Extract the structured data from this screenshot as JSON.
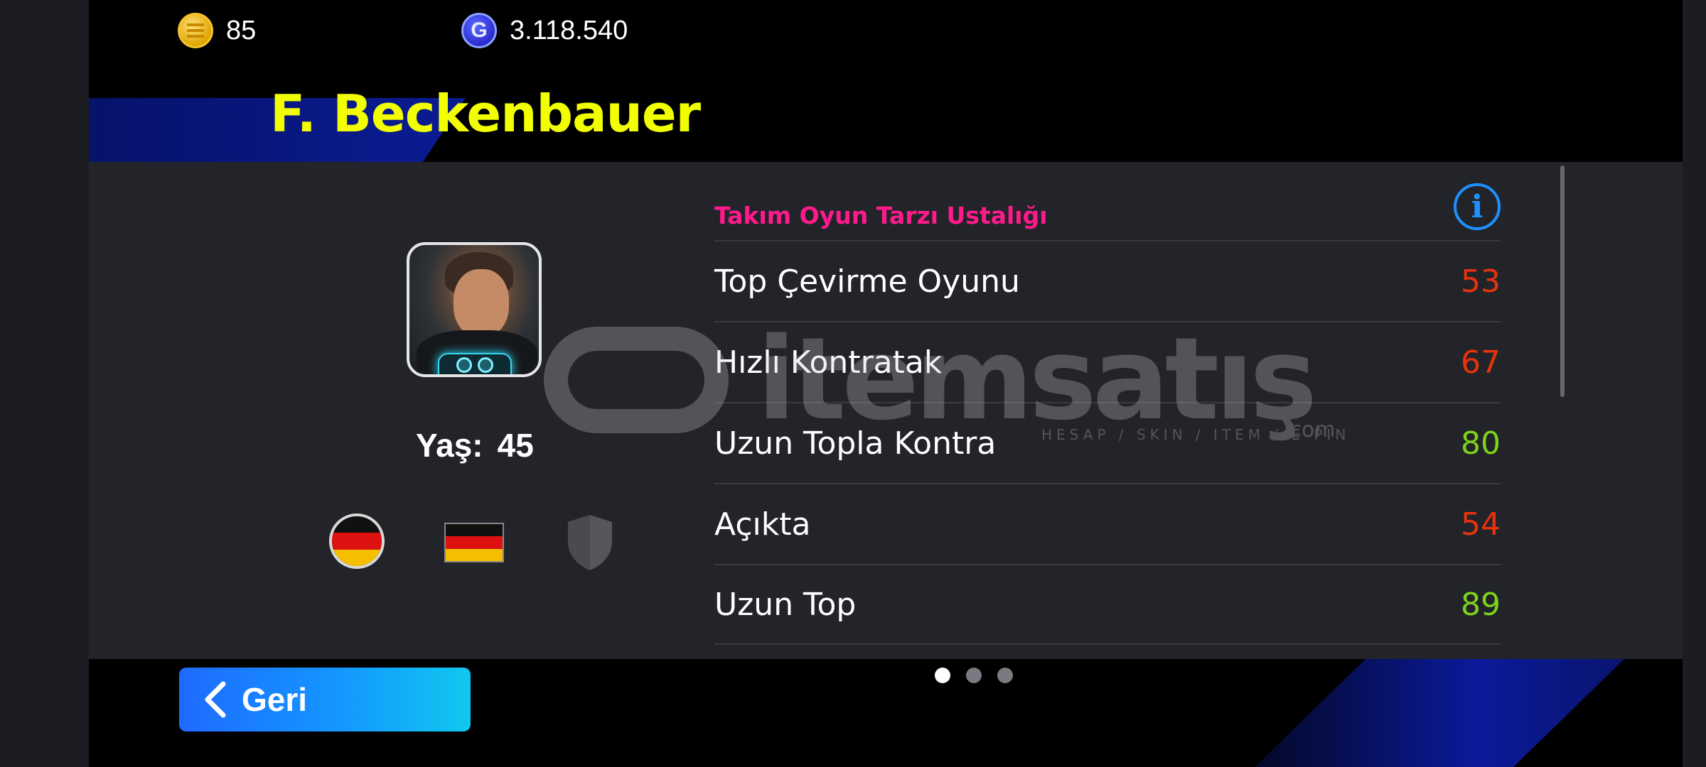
{
  "currency": {
    "coins": {
      "icon": "efootball-coin-icon",
      "value": "85"
    },
    "gp": {
      "icon": "gp-coin-icon",
      "value": "3.118.540"
    }
  },
  "player": {
    "name": "F. Beckenbauer",
    "age_label": "Yaş:",
    "age_value": "45",
    "nationality_icon": "germany-flag-icon",
    "region_icon": "germany-flag-icon",
    "club_icon": "club-shield-icon"
  },
  "stats_section": {
    "title": "Takım Oyun Tarzı Ustalığı",
    "info_icon": "info-icon",
    "rows": [
      {
        "name": "Top Çevirme Oyunu",
        "value": "53",
        "color": "#e8320c"
      },
      {
        "name": "Hızlı Kontratak",
        "value": "67",
        "color": "#e8320c"
      },
      {
        "name": "Uzun Topla Kontra",
        "value": "80",
        "color": "#7ed31a"
      },
      {
        "name": "Açıkta",
        "value": "54",
        "color": "#e8320c"
      },
      {
        "name": "Uzun Top",
        "value": "89",
        "color": "#7ed31a"
      }
    ]
  },
  "watermark": {
    "brand": "itemsatış",
    "tagline": "HESAP / SKIN / ITEM / E-PIN",
    "suffix": ".com"
  },
  "pagination": {
    "pages": 3,
    "active": 1
  },
  "footer": {
    "back_label": "Geri",
    "back_icon": "chevron-left-icon"
  },
  "colors": {
    "name": "#f2ff00",
    "section_title": "#ff1a8c",
    "accent": "#1e90ff",
    "stat_low": "#e8320c",
    "stat_high": "#7ed31a"
  }
}
